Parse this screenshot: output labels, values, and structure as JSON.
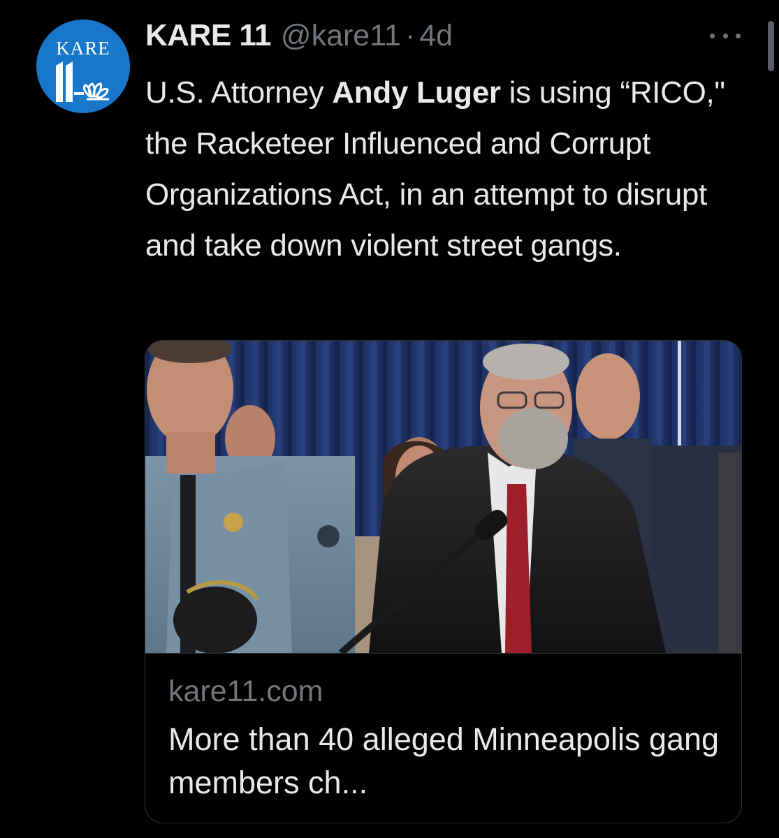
{
  "tweet": {
    "avatar_text": "KARE",
    "display_name": "KARE 11",
    "handle": "@kare11",
    "separator": "·",
    "age": "4d",
    "text_before": "U.S. Attorney ",
    "text_bold": "Andy Luger",
    "text_after": " is using “RICO,\" the Racketeer Influenced and Corrupt Organizations Act, in an attempt to disrupt and take down violent street gangs."
  },
  "card": {
    "domain": "kare11.com",
    "title": "More than 40 alleged Minneapolis gang members ch..."
  },
  "colors": {
    "background": "#000000",
    "primary_text": "#e7e9ea",
    "secondary_text": "#71767b",
    "avatar_blue": "#1877c9",
    "border": "#2f3336"
  },
  "icons": [
    "more-options-icon",
    "kare11-logo-icon",
    "peacock-icon"
  ]
}
